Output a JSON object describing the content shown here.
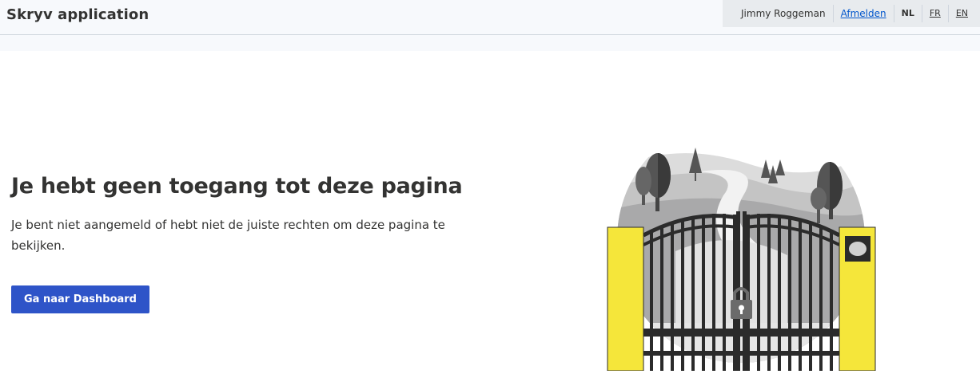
{
  "header": {
    "app_title": "Skryv application",
    "user_name": "Jimmy Roggeman",
    "logout_label": "Afmelden",
    "languages": [
      {
        "code": "NL",
        "active": true
      },
      {
        "code": "FR",
        "active": false
      },
      {
        "code": "EN",
        "active": false
      }
    ]
  },
  "main": {
    "heading": "Je hebt geen toegang tot deze pagina",
    "message": "Je bent niet aangemeld of hebt niet de juiste rechten om deze pagina te bekijken.",
    "button_label": "Ga naar Dashboard"
  },
  "illustration": {
    "semantic": "locked-gate-illustration",
    "colors": {
      "pillar": "#f5e63a",
      "gate": "#2b2b2b",
      "landscape": "#c8c8c8",
      "button_accent": "#2e54c8"
    }
  }
}
